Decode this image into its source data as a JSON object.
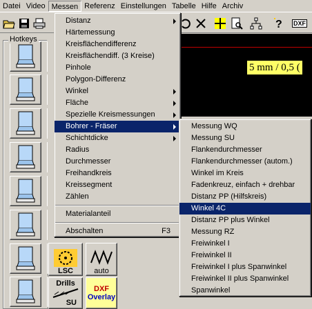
{
  "menubar": {
    "items": [
      "Datei",
      "Video",
      "Messen",
      "Referenz",
      "Einstellungen",
      "Tabelle",
      "Hilfe",
      "Archiv"
    ],
    "open_item": "Messen"
  },
  "toolbar": {
    "icons": [
      "open-folder-icon",
      "save-icon",
      "print-icon",
      "undo-icon",
      "close-x-icon",
      "crosshair-icon",
      "zoom-page-icon",
      "network-icon",
      "help-icon",
      "dxf-icon",
      "camera-icon"
    ],
    "dxf_label": "DXF"
  },
  "hotkeys": {
    "label": "Hotkeys"
  },
  "display": {
    "scale_text": "5 mm / 0,5 ("
  },
  "tools": {
    "lsc_label": "LSC",
    "auto_label": "auto",
    "drills_label": "Drills",
    "su_label": "SU",
    "dxf_overlay_line1": "DXF",
    "dxf_overlay_line2": "Overlay"
  },
  "messen_menu": {
    "groups": [
      [
        {
          "label": "Distanz",
          "submenu": true
        },
        {
          "label": "Härtemessung",
          "submenu": false
        },
        {
          "label": "Kreisflächendifferenz",
          "submenu": false
        },
        {
          "label": "Kreisflächendiff. (3 Kreise)",
          "submenu": false
        },
        {
          "label": "Pinhole",
          "submenu": false
        },
        {
          "label": "Polygon-Differenz",
          "submenu": false
        },
        {
          "label": "Winkel",
          "submenu": true
        },
        {
          "label": "Fläche",
          "submenu": true
        },
        {
          "label": "Spezielle Kreismessungen",
          "submenu": true
        },
        {
          "label": "Bohrer - Fräser",
          "submenu": true,
          "highlighted": true
        },
        {
          "label": "Schichtdicke",
          "submenu": true
        },
        {
          "label": "Radius",
          "submenu": false
        },
        {
          "label": "Durchmesser",
          "submenu": false
        },
        {
          "label": "Freihandkreis",
          "submenu": false
        },
        {
          "label": "Kreissegment",
          "submenu": false
        },
        {
          "label": "Zählen",
          "submenu": false
        }
      ],
      [
        {
          "label": "Materialanteil",
          "submenu": false
        }
      ],
      [
        {
          "label": "Abschalten",
          "submenu": false,
          "shortcut": "F3"
        }
      ]
    ]
  },
  "bohrer_submenu": {
    "items": [
      {
        "label": "Messung WQ"
      },
      {
        "label": "Messung SU"
      },
      {
        "label": "Flankendurchmesser"
      },
      {
        "label": "Flankendurchmesser (autom.)"
      },
      {
        "label": "Winkel im Kreis"
      },
      {
        "label": "Fadenkreuz, einfach + drehbar"
      },
      {
        "label": "Distanz PP (Hilfskreis)"
      },
      {
        "label": "Winkel 4C",
        "highlighted": true
      },
      {
        "label": "Distanz PP plus Winkel"
      },
      {
        "label": "Messung RZ"
      },
      {
        "label": "Freiwinkel I"
      },
      {
        "label": "Freiwinkel II"
      },
      {
        "label": "Freiwinkel I plus Spanwinkel"
      },
      {
        "label": "Freiwinkel II plus Spanwinkel"
      },
      {
        "label": "Spanwinkel"
      }
    ]
  },
  "colors": {
    "highlight": "#0a246a",
    "scale_label_bg": "#ffff66",
    "face": "#d4d0c8"
  }
}
